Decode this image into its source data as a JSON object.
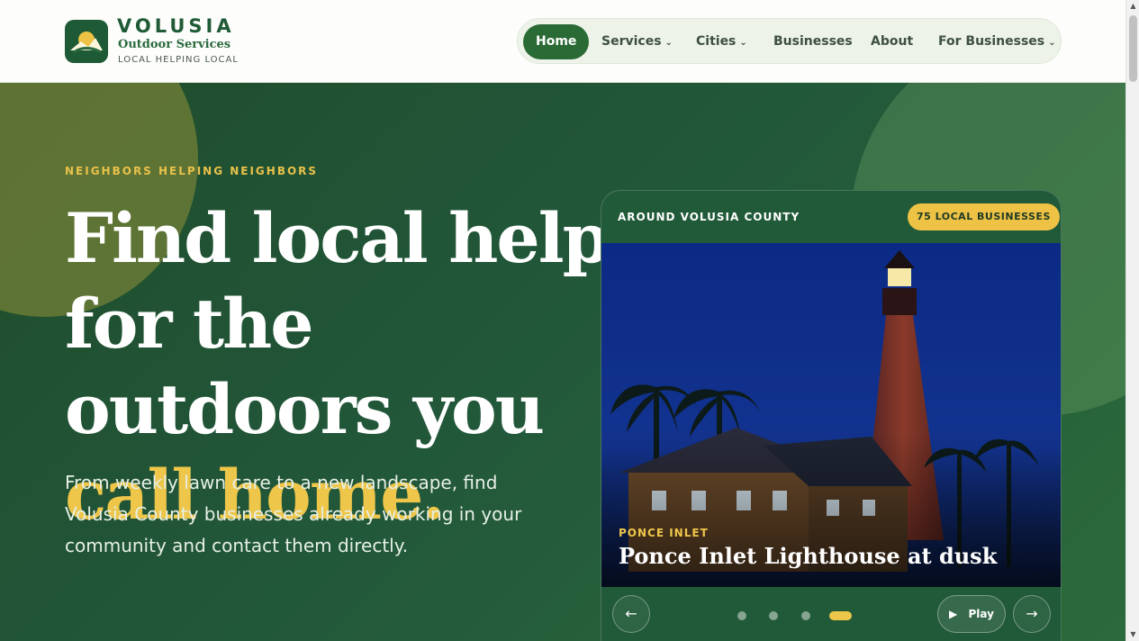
{
  "brand": {
    "name": "VOLUSIA",
    "subtitle": "Outdoor Services",
    "tagline": "LOCAL HELPING LOCAL"
  },
  "nav": {
    "items": [
      {
        "label": "Home",
        "active": true,
        "dropdown": false
      },
      {
        "label": "Services",
        "active": false,
        "dropdown": true
      },
      {
        "label": "Cities",
        "active": false,
        "dropdown": true
      },
      {
        "label": "Businesses",
        "active": false,
        "dropdown": false
      },
      {
        "label": "About",
        "active": false,
        "dropdown": false
      },
      {
        "label": "For Businesses",
        "active": false,
        "dropdown": true
      }
    ],
    "caret": "⌄"
  },
  "hero": {
    "eyebrow": "NEIGHBORS HELPING NEIGHBORS",
    "headline_lines": [
      "Find local help",
      "for the",
      "outdoors you",
      "call home."
    ],
    "lead": "From weekly lawn care to a new landscape, find Volusia County businesses already working in your community and contact them directly."
  },
  "card": {
    "title": "AROUND VOLUSIA COUNTY",
    "badge": "75 LOCAL BUSINESSES",
    "slide": {
      "location": "PONCE INLET",
      "caption": "Ponce Inlet Lighthouse at dusk"
    },
    "controls": {
      "prev": "←",
      "next": "→",
      "play_label": "Play",
      "play_icon": "▶",
      "slide_count": 4,
      "active_slide": 4
    }
  },
  "colors": {
    "brand_green": "#1f5a36",
    "accent_gold": "#eec64a",
    "hero_bg": "#22573a"
  },
  "scrollbar": {
    "up": "▲",
    "down": "▼"
  }
}
